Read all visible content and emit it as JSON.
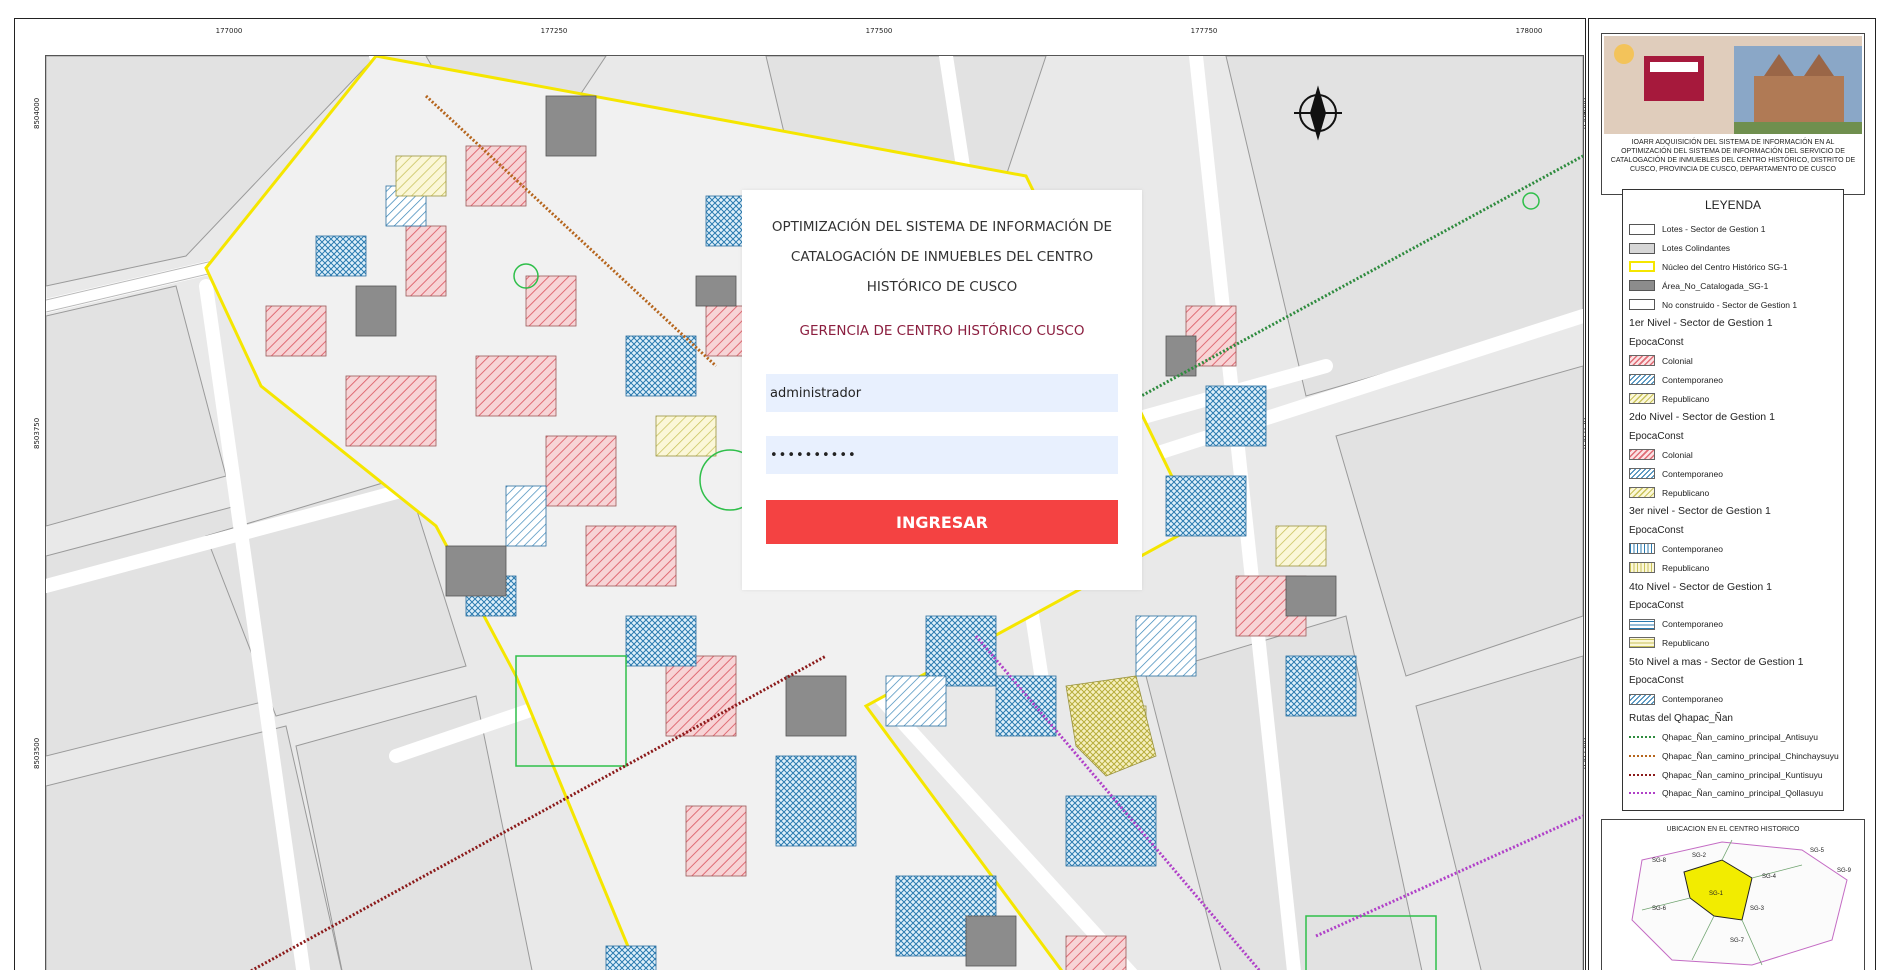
{
  "map": {
    "coords_top": [
      "177000",
      "177250",
      "177500",
      "177750",
      "178000"
    ],
    "coords_left": [
      "8504000",
      "8503750",
      "8503500"
    ],
    "coords_right": [
      "8504000",
      "8503750",
      "8503500"
    ]
  },
  "login": {
    "title": "OPTIMIZACIÓN DEL SISTEMA DE INFORMACIÓN DE CATALOGACIÓN DE INMUEBLES DEL CENTRO HISTÓRICO DE CUSCO",
    "organization": "GERENCIA DE CENTRO HISTÓRICO CUSCO",
    "username_value": "administrador",
    "password_value": "••••••••••",
    "submit_label": "INGRESAR"
  },
  "title_block": {
    "text": "IOARR ADQUISICIÓN DEL SISTEMA DE INFORMACIÓN EN AL OPTIMIZACIÓN DEL SISTEMA DE INFORMACIÓN DEL SERVICIO DE CATALOGACIÓN DE INMUEBLES DEL CENTRO HISTÓRICO, DISTRITO DE CUSCO, PROVINCIA DE CUSCO, DEPARTAMENTO DE CUSCO"
  },
  "legend": {
    "title": "LEYENDA",
    "items": [
      {
        "kind": "swatch",
        "label": "Lotes - Sector de Gestion 1",
        "fill": "#ffffff",
        "border": "#555555"
      },
      {
        "kind": "swatch",
        "label": "Lotes Colindantes",
        "fill": "#d6d6d6",
        "border": "#555555"
      },
      {
        "kind": "swatch",
        "label": "Núcleo del Centro Histórico SG-1",
        "fill": "#ffffff",
        "border": "#f5e600"
      },
      {
        "kind": "swatch",
        "label": "Área_No_Catalogada_SG-1",
        "fill": "#8c8c8c",
        "border": "#555555"
      },
      {
        "kind": "swatch",
        "label": "No construido - Sector de Gestion 1",
        "fill": "#ffffff",
        "border": "#555555"
      },
      {
        "kind": "heading",
        "label": "1er Nivel - Sector de Gestion 1"
      },
      {
        "kind": "epoca",
        "label": "EpocaConst"
      },
      {
        "kind": "swatch",
        "label": "Colonial",
        "pattern": "colonial"
      },
      {
        "kind": "swatch",
        "label": "Contemporaneo",
        "pattern": "contemp"
      },
      {
        "kind": "swatch",
        "label": "Republicano",
        "pattern": "repub"
      },
      {
        "kind": "heading",
        "label": "2do Nivel - Sector de Gestion 1"
      },
      {
        "kind": "epoca",
        "label": "EpocaConst"
      },
      {
        "kind": "swatch",
        "label": "Colonial",
        "pattern": "colonial"
      },
      {
        "kind": "swatch",
        "label": "Contemporaneo",
        "pattern": "contemp"
      },
      {
        "kind": "swatch",
        "label": "Republicano",
        "pattern": "repub"
      },
      {
        "kind": "heading",
        "label": "3er nivel - Sector de Gestion 1"
      },
      {
        "kind": "epoca",
        "label": "EpocaConst"
      },
      {
        "kind": "swatch",
        "label": "Contemporaneo",
        "pattern": "contemp-v"
      },
      {
        "kind": "swatch",
        "label": "Republicano",
        "pattern": "repub-v"
      },
      {
        "kind": "heading",
        "label": "4to Nivel - Sector de Gestion 1"
      },
      {
        "kind": "epoca",
        "label": "EpocaConst"
      },
      {
        "kind": "swatch",
        "label": "Contemporaneo",
        "pattern": "contemp-h"
      },
      {
        "kind": "swatch",
        "label": "Republicano",
        "pattern": "repub-h"
      },
      {
        "kind": "heading",
        "label": "5to Nivel a mas - Sector de Gestion 1"
      },
      {
        "kind": "epoca",
        "label": "EpocaConst"
      },
      {
        "kind": "swatch",
        "label": "Contemporaneo",
        "pattern": "contemp"
      },
      {
        "kind": "epoca",
        "label": "Rutas del Qhapac_Ñan"
      },
      {
        "kind": "line",
        "label": "Qhapac_Ñan_camino_principal_Antisuyu",
        "color": "#2e8b3e"
      },
      {
        "kind": "line",
        "label": "Qhapac_Ñan_camino_principal_Chinchaysuyu",
        "color": "#b5651d"
      },
      {
        "kind": "line",
        "label": "Qhapac_Ñan_camino_principal_Kuntisuyu",
        "color": "#8b1a1a"
      },
      {
        "kind": "line",
        "label": "Qhapac_Ñan_camino_principal_Qollasuyu",
        "color": "#b040c8"
      }
    ]
  },
  "inset": {
    "title": "UBICACION EN EL CENTRO HISTORICO",
    "sectors": [
      "SG-1",
      "SG-2",
      "SG-3",
      "SG-4",
      "SG-5",
      "SG-6",
      "SG-7",
      "SG-8",
      "SG-9"
    ]
  }
}
